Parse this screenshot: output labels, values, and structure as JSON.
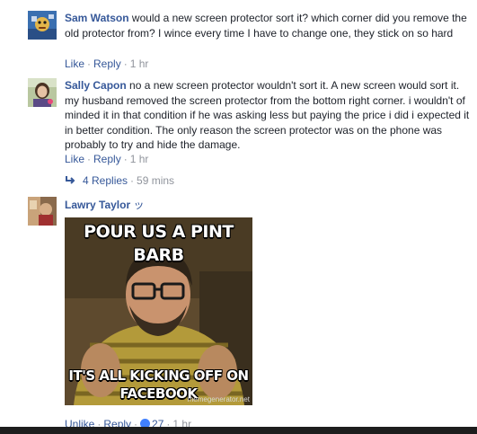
{
  "comments": [
    {
      "author": "Sam Watson",
      "text": " would a new screen protector sort it? which corner did you remove the old protector from? I wince every time I have to change one, they stick on so hard",
      "like_label": "Like",
      "reply_label": "Reply",
      "time": "1 hr"
    },
    {
      "author": "Sally Capon",
      "text": " no a new screen protector wouldn't sort it. A new screen would sort it. my husband removed the screen protector from the bottom right corner. i wouldn't of minded it in that condition if he was asking less but paying the price i did i expected it in better condition. The only reason the screen protector was on the phone was probably to try and hide the damage.",
      "like_label": "Like",
      "reply_label": "Reply",
      "time": "1 hr",
      "replies_label": "4 Replies",
      "replies_time": "59 mins"
    },
    {
      "author": "Lawry Taylor",
      "author_suffix": "ッ",
      "meme_top": "POUR US A PINT",
      "meme_top2": "BARB",
      "meme_bottom": "IT'S ALL KICKING OFF ON",
      "meme_bottom2": "FACEBOOK",
      "meme_watermark": "memegenerator.net",
      "unlike_label": "Unlike",
      "reply_label": "Reply",
      "like_count": "27",
      "time": "1 hr"
    }
  ],
  "icons": {
    "reply_arrow": "reply-arrow-icon",
    "like_badge": "like-badge-icon"
  },
  "colors": {
    "link": "#365899",
    "meta": "#90949c",
    "text": "#1d2129",
    "like_badge": "#4080ff"
  }
}
